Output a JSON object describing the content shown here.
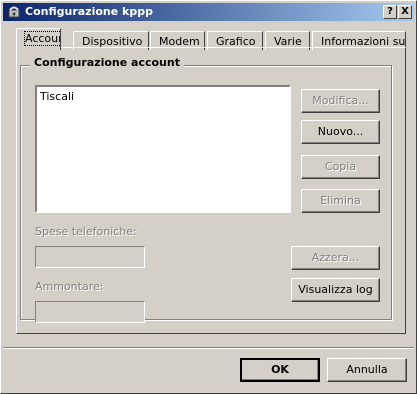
{
  "window": {
    "title": "Configurazione kppp",
    "help_button": "?",
    "close_button": "X"
  },
  "tabs": [
    "Account",
    "Dispositivo",
    "Modem",
    "Grafico",
    "Varie",
    "Informazioni su"
  ],
  "group": {
    "title": "Configurazione account",
    "accounts": [
      "Tiscali"
    ]
  },
  "buttons": {
    "modifica": "Modifica...",
    "nuovo": "Nuovo...",
    "copia": "Copia",
    "elimina": "Elimina",
    "azzera": "Azzera...",
    "visualizza_log": "Visualizza log"
  },
  "costs": {
    "spese_label": "Spese telefoniche:",
    "spese_value": "",
    "ammontare_label": "Ammontare:",
    "ammontare_value": ""
  },
  "footer": {
    "ok": "OK",
    "annulla": "Annulla"
  }
}
